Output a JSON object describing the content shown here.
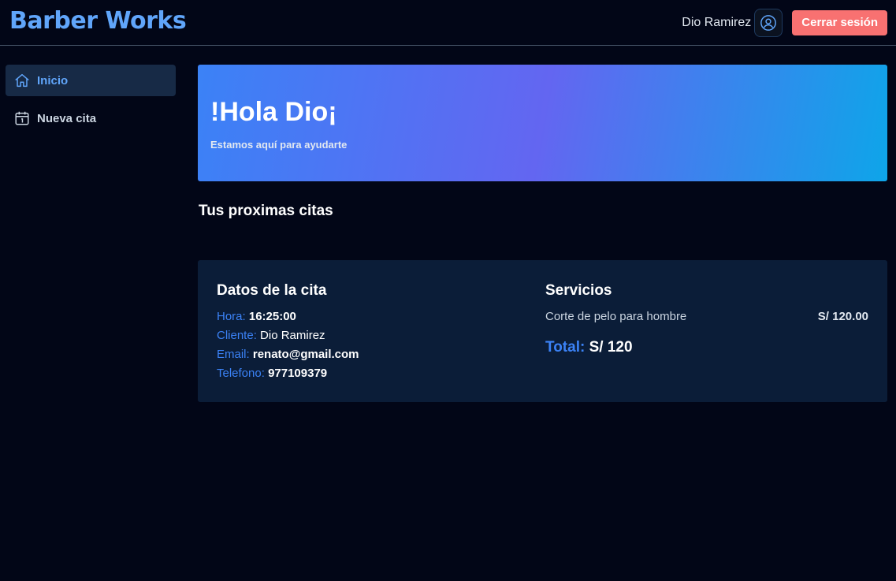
{
  "header": {
    "brand": "Barber Works",
    "user_name": "Dio Ramirez",
    "logout_label": "Cerrar sesión"
  },
  "sidebar": {
    "items": [
      {
        "label": "Inicio",
        "icon": "home-icon",
        "active": true
      },
      {
        "label": "Nueva cita",
        "icon": "calendar-icon",
        "active": false
      }
    ]
  },
  "hero": {
    "title": "!Hola Dio¡",
    "subtitle": "Estamos aquí para ayudarte"
  },
  "appointments": {
    "section_title": "Tus proximas citas",
    "card": {
      "details_title": "Datos de la cita",
      "fields": [
        {
          "label": "Hora:",
          "value": "16:25:00"
        },
        {
          "label": "Cliente:",
          "value": "Dio Ramirez"
        },
        {
          "label": "Email:",
          "value": "renato@gmail.com"
        },
        {
          "label": "Telefono:",
          "value": "977109379"
        }
      ],
      "services_title": "Servicios",
      "services": [
        {
          "name": "Corte de pelo para hombre",
          "price": "S/ 120.00"
        }
      ],
      "total_label": "Total:",
      "total_value": "S/ 120"
    }
  },
  "colors": {
    "background": "#020617",
    "brand": "#60a5fa",
    "accent": "#3b82f6",
    "logout": "#f87171",
    "card": "#0b1d38"
  }
}
